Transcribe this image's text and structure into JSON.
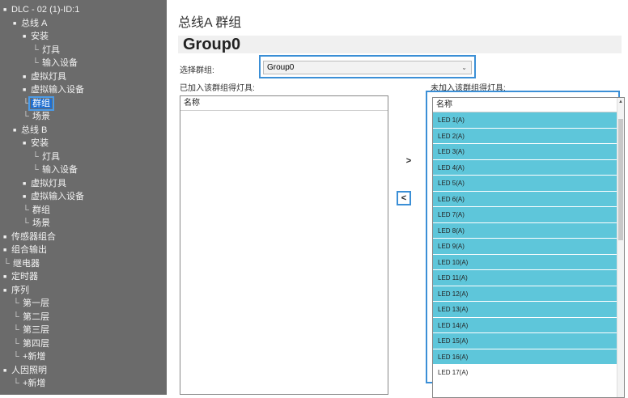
{
  "tree": [
    {
      "label": "DLC - 02 (1)-ID:1",
      "toggle": "■",
      "indent": 0
    },
    {
      "label": "总线 A",
      "toggle": "■",
      "indent": 1
    },
    {
      "label": "安装",
      "toggle": "■",
      "indent": 2
    },
    {
      "label": "灯具",
      "toggle": "",
      "indent": 3
    },
    {
      "label": "输入设备",
      "toggle": "",
      "indent": 3
    },
    {
      "label": "虚拟灯具",
      "toggle": "■",
      "indent": 2
    },
    {
      "label": "虚拟输入设备",
      "toggle": "■",
      "indent": 2
    },
    {
      "label": "群组",
      "toggle": "",
      "indent": 2,
      "selected": true
    },
    {
      "label": "场景",
      "toggle": "",
      "indent": 2
    },
    {
      "label": "总线 B",
      "toggle": "■",
      "indent": 1
    },
    {
      "label": "安装",
      "toggle": "■",
      "indent": 2
    },
    {
      "label": "灯具",
      "toggle": "",
      "indent": 3
    },
    {
      "label": "输入设备",
      "toggle": "",
      "indent": 3
    },
    {
      "label": "虚拟灯具",
      "toggle": "■",
      "indent": 2
    },
    {
      "label": "虚拟输入设备",
      "toggle": "■",
      "indent": 2
    },
    {
      "label": "群组",
      "toggle": "",
      "indent": 2
    },
    {
      "label": "场景",
      "toggle": "",
      "indent": 2
    },
    {
      "label": "传感器组合",
      "toggle": "■",
      "indent": 0
    },
    {
      "label": "组合输出",
      "toggle": "■",
      "indent": 0
    },
    {
      "label": "继电器",
      "toggle": "",
      "indent": 0
    },
    {
      "label": "定时器",
      "toggle": "■",
      "indent": 0
    },
    {
      "label": "序列",
      "toggle": "■",
      "indent": 0
    },
    {
      "label": "第一层",
      "toggle": "",
      "indent": 1
    },
    {
      "label": "第二层",
      "toggle": "",
      "indent": 1
    },
    {
      "label": "第三层",
      "toggle": "",
      "indent": 1
    },
    {
      "label": "第四层",
      "toggle": "",
      "indent": 1
    },
    {
      "label": "+新增",
      "toggle": "",
      "indent": 1
    },
    {
      "label": "人因照明",
      "toggle": "■",
      "indent": 0
    },
    {
      "label": "+新增",
      "toggle": "",
      "indent": 1
    }
  ],
  "main": {
    "bus_title": "总线A 群组",
    "group_title": "Group0",
    "select_label": "选择群组:",
    "select_value": "Group0",
    "select_arrow": "⌄",
    "added_label": "已加入该群组得灯具:",
    "not_added_label": "未加入该群组得灯具:",
    "name_header": "名称",
    "add_button": ">",
    "remove_button": "<",
    "scroll_up": "▲",
    "not_added_items": [
      "LED 1(A)",
      "LED 2(A)",
      "LED 3(A)",
      "LED 4(A)",
      "LED 5(A)",
      "LED 6(A)",
      "LED 7(A)",
      "LED 8(A)",
      "LED 9(A)",
      "LED 10(A)",
      "LED 11(A)",
      "LED 12(A)",
      "LED 13(A)",
      "LED 14(A)",
      "LED 15(A)",
      "LED 16(A)",
      "LED 17(A)"
    ]
  }
}
